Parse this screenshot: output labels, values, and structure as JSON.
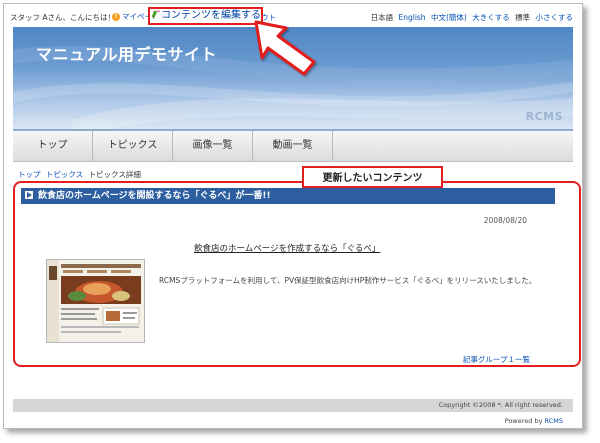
{
  "topbar": {
    "greeting": "スタッフ Aさん、こんにちは！",
    "mypage_label": "マイペー",
    "edit_label": "コンテンツを編集する",
    "logout_fragment": "ウト",
    "lang_current": "日本語",
    "lang_english": "English",
    "lang_chinese": "中文(簡体)",
    "font_large": "大きくする",
    "font_normal": "標準",
    "font_small": "小さくする"
  },
  "banner": {
    "site_title": "マニュアル用デモサイト",
    "watermark": "RCMS"
  },
  "nav": {
    "items": [
      "トップ",
      "トピックス",
      "画像一覧",
      "動画一覧"
    ]
  },
  "breadcrumb": {
    "top": "トップ",
    "topics": "トピックス",
    "current": "トピックス詳細"
  },
  "callout": {
    "label": "更新したいコンテンツ"
  },
  "article": {
    "header": "飲食店のホームページを開設するなら「ぐるべ」が一番!!",
    "date": "2008/08/20",
    "title": "飲食店のホームページを作成するなら「ぐるべ」",
    "body": "RCMSプラットフォームを利用して、PV保証型飲食店向けHP制作サービス「ぐるべ」をリリースいたしました。",
    "group_link": "記事グループ１一覧"
  },
  "footer": {
    "copyright": "Copyright ©2008 *. All right reserved.",
    "powered_prefix": "Powered by",
    "powered_brand": "RCMS"
  },
  "colors": {
    "highlight_red": "#e31e1e",
    "header_blue": "#2c5ea0",
    "link_blue": "#0050b4"
  }
}
